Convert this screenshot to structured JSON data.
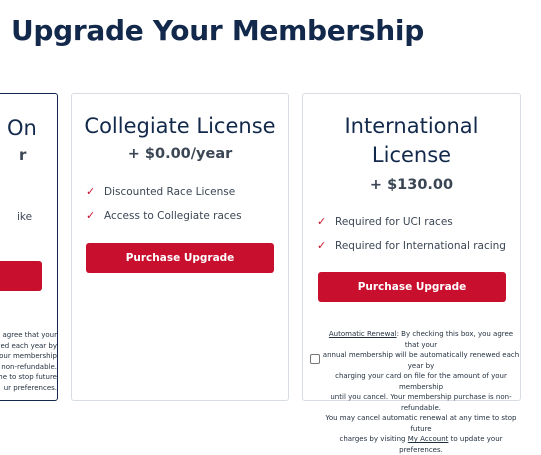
{
  "page": {
    "title": "Upgrade Your Membership"
  },
  "cards": {
    "left": {
      "title_fragment_1": "On",
      "title_fragment_2": "r",
      "feature_fragment": "ike",
      "renewal_fragments": [
        "agree that your",
        "ewed each year by",
        "our membership",
        "is non-refundable.",
        "ime to stop future",
        "ur preferences."
      ]
    },
    "collegiate": {
      "title": "Collegiate License",
      "price": "+ $0.00/year",
      "features": [
        "Discounted Race License",
        "Access to Collegiate races"
      ],
      "button": "Purchase Upgrade"
    },
    "international": {
      "title_line1": "International",
      "title_line2": "License",
      "price": "+ $130.00",
      "features": [
        "Required for UCI races",
        "Required for International racing"
      ],
      "button": "Purchase Upgrade",
      "renewal": {
        "label": "Automatic Renewal",
        "line1_rest": ": By checking this box, you agree that your",
        "line2": "annual membership will be automatically renewed each year by",
        "line3": "charging your card on file for the amount of your membership",
        "line4": "until you cancel. Your membership purchase is non-refundable.",
        "line5": "You may cancel automatic renewal at any time to stop future",
        "line6_before": "charges by visiting ",
        "link": "My Account",
        "line6_after": " to update your preferences."
      }
    }
  },
  "icons": {
    "check": "✓"
  },
  "colors": {
    "brand_navy": "#13294b",
    "brand_red": "#c8102e"
  }
}
